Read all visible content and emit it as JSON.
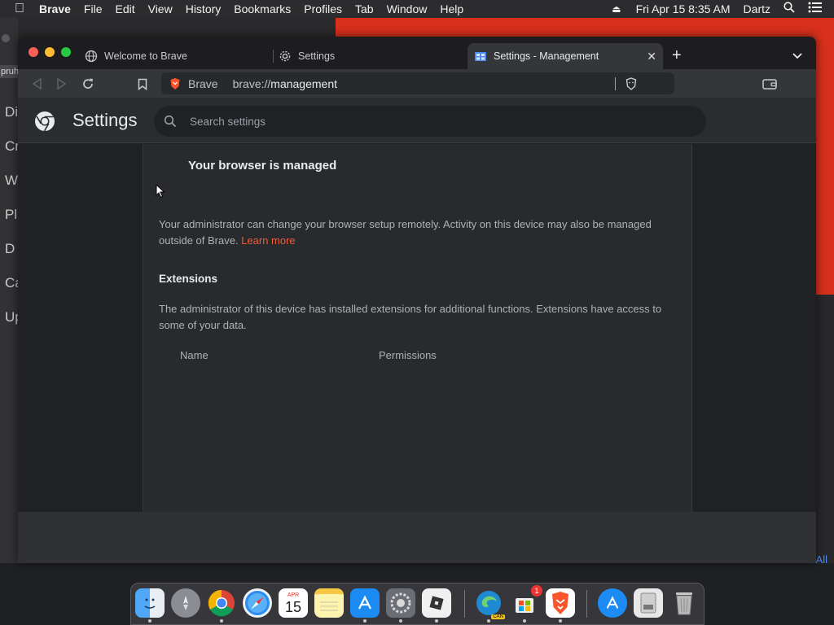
{
  "menubar": {
    "app_name": "Brave",
    "items": [
      "File",
      "Edit",
      "View",
      "History",
      "Bookmarks",
      "Profiles",
      "Tab",
      "Window",
      "Help"
    ],
    "datetime": "Fri Apr 15  8:35 AM",
    "user": "Dartz"
  },
  "desktop": {
    "sidebar_partial_items": [
      "Di",
      "Cr",
      "W",
      "Pl",
      "D",
      "Ca",
      "Up"
    ],
    "top_left_fragment": "pruh",
    "bottom_right_fragment": "All"
  },
  "tabs": [
    {
      "label": "Welcome to Brave",
      "icon": "globe-icon"
    },
    {
      "label": "Settings",
      "icon": "gear-icon"
    },
    {
      "label": "Settings - Management",
      "icon": "management-icon",
      "active": true
    }
  ],
  "toolbar": {
    "site_label": "Brave",
    "url_prefix": "brave://",
    "url_host": "management"
  },
  "settings": {
    "title": "Settings",
    "search_placeholder": "Search settings"
  },
  "management": {
    "title": "Your browser is managed",
    "description": "Your administrator can change your browser setup remotely. Activity on this device may also be managed outside of Brave.",
    "learn_more": "Learn more",
    "extensions_heading": "Extensions",
    "extensions_description": "The administrator of this device has installed extensions for additional functions. Extensions have access to some of your data.",
    "columns": [
      "Name",
      "Permissions"
    ]
  },
  "dock": {
    "apps": [
      "Finder",
      "Launchpad",
      "Chrome",
      "Safari",
      "Calendar",
      "Notes",
      "App Store",
      "System Preferences",
      "Roblox",
      "Edge Canary",
      "Microsoft Store",
      "Brave",
      "App Store Downloads",
      "Disk Utility",
      "Trash"
    ],
    "calendar_month": "APR",
    "calendar_day": "15",
    "badge_count": "1",
    "edge_badge": "CAN"
  },
  "colors": {
    "accent_link": "#ee5d3c",
    "active_tab_icon": "#4c8df6",
    "brave_orange": "#fb542b"
  }
}
